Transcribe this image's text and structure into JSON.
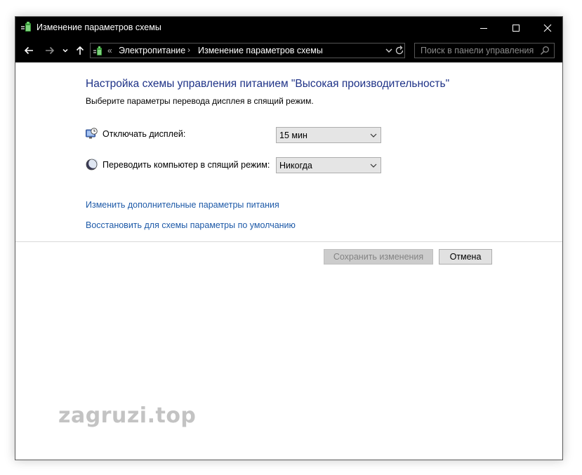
{
  "window": {
    "title": "Изменение параметров схемы"
  },
  "navbar": {
    "breadcrumb_prefix": "«",
    "breadcrumb_separator": "›",
    "breadcrumbs": [
      "Электропитание",
      "Изменение параметров схемы"
    ],
    "search_placeholder": "Поиск в панели управления"
  },
  "main": {
    "heading": "Настройка схемы управления питанием \"Высокая производительность\"",
    "subtitle": "Выберите параметры перевода дисплея в спящий режим.",
    "settings": [
      {
        "label": "Отключать дисплей:",
        "value": "15 мин",
        "icon": "monitor-clock-icon"
      },
      {
        "label": "Переводить компьютер в спящий режим:",
        "value": "Никогда",
        "icon": "moon-sleep-icon"
      }
    ],
    "links": [
      "Изменить дополнительные параметры питания",
      "Восстановить для схемы параметры по умолчанию"
    ],
    "buttons": {
      "save": "Сохранить изменения",
      "cancel": "Отмена"
    }
  },
  "watermark": "zagruzi.top",
  "colors": {
    "titlebar": "#000000",
    "heading": "#1e3287",
    "link": "#1e5aa8",
    "disabled_text": "#838383"
  }
}
